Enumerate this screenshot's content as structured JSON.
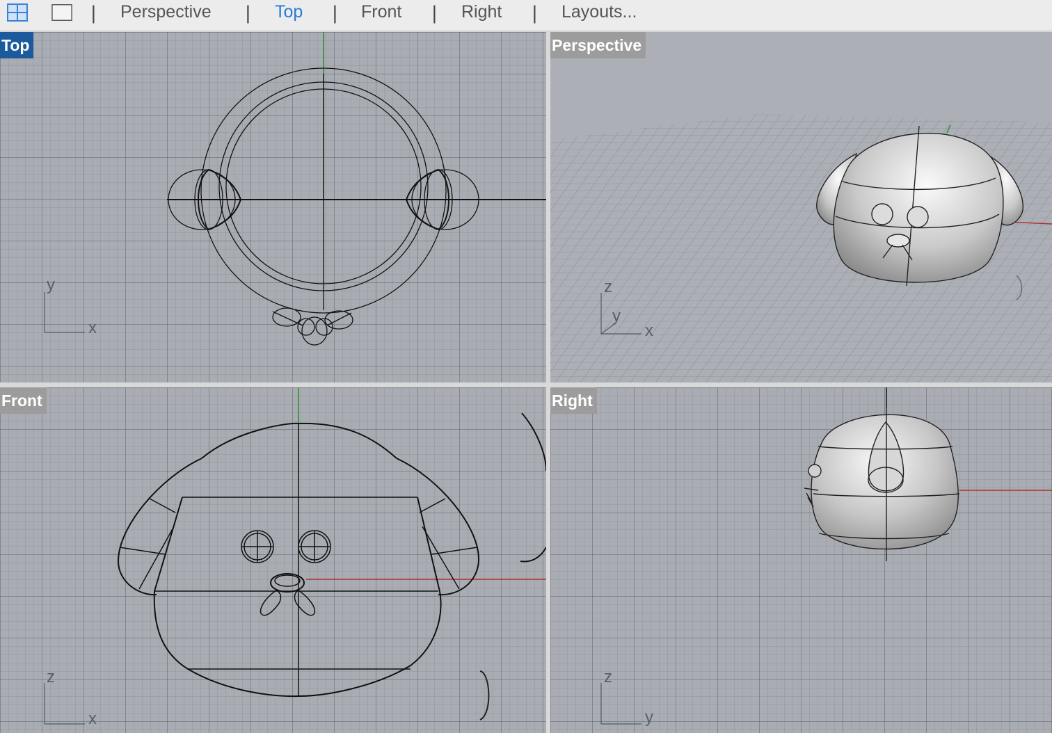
{
  "toolbar": {
    "icons": [
      "four-viewports-icon",
      "single-viewport-icon"
    ],
    "separator": "|",
    "tabs": [
      {
        "label": "Perspective",
        "active": false
      },
      {
        "label": "Top",
        "active": true
      },
      {
        "label": "Front",
        "active": false
      },
      {
        "label": "Right",
        "active": false
      },
      {
        "label": "Layouts...",
        "active": false
      }
    ]
  },
  "viewports": {
    "top": {
      "label": "Top",
      "active": true,
      "axes": [
        "y",
        "x"
      ]
    },
    "perspective": {
      "label": "Perspective",
      "active": false,
      "axes": [
        "z",
        "y",
        "x"
      ]
    },
    "front": {
      "label": "Front",
      "active": false,
      "axes": [
        "z",
        "x"
      ]
    },
    "right": {
      "label": "Right",
      "active": false,
      "axes": [
        "z",
        "y"
      ]
    }
  },
  "colors": {
    "accent": "#2a7ad8",
    "active_label": "#1b5a9c",
    "inactive_label": "#9c9c9c",
    "viewport_bg": "#a9adb3",
    "x_axis": "#b03030",
    "y_axis": "#2a8a2a"
  }
}
